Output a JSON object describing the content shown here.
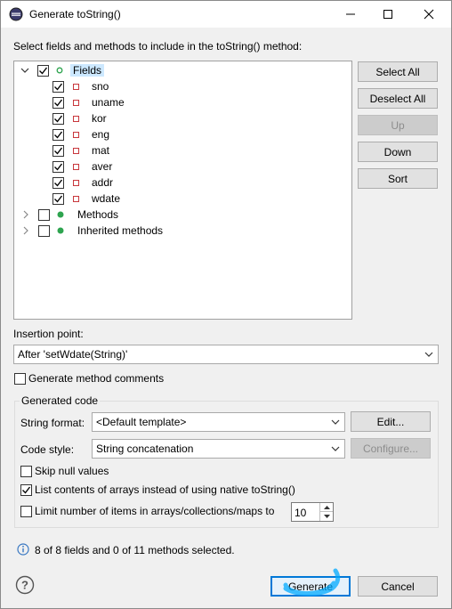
{
  "window": {
    "title": "Generate toString()"
  },
  "prompt": "Select fields and methods to include in the toString() method:",
  "tree": {
    "fields_label": "Fields",
    "fields": [
      "sno",
      "uname",
      "kor",
      "eng",
      "mat",
      "aver",
      "addr",
      "wdate"
    ],
    "methods_label": "Methods",
    "inherited_label": "Inherited methods"
  },
  "side_buttons": {
    "select_all": "Select All",
    "deselect_all": "Deselect All",
    "up": "Up",
    "down": "Down",
    "sort": "Sort"
  },
  "insertion": {
    "label": "Insertion point:",
    "value": "After 'setWdate(String)'"
  },
  "method_comments": "Generate method comments",
  "generated_code": {
    "title": "Generated code",
    "string_format_label": "String format:",
    "string_format_value": "<Default template>",
    "edit_label": "Edit...",
    "code_style_label": "Code style:",
    "code_style_value": "String concatenation",
    "configure_label": "Configure...",
    "skip_null": "Skip null values",
    "list_arrays": "List contents of arrays instead of using native toString()",
    "limit_items": "Limit number of items in arrays/collections/maps to",
    "limit_value": "10"
  },
  "status": "8 of 8 fields and 0 of 11 methods selected.",
  "footer": {
    "generate": "Generate",
    "cancel": "Cancel"
  },
  "colors": {
    "accent": "#0078d7",
    "highlight": "#00aaff",
    "selection": "#cce8ff",
    "field_icon": "#c8373c",
    "method_icon": "#2ea44f"
  }
}
